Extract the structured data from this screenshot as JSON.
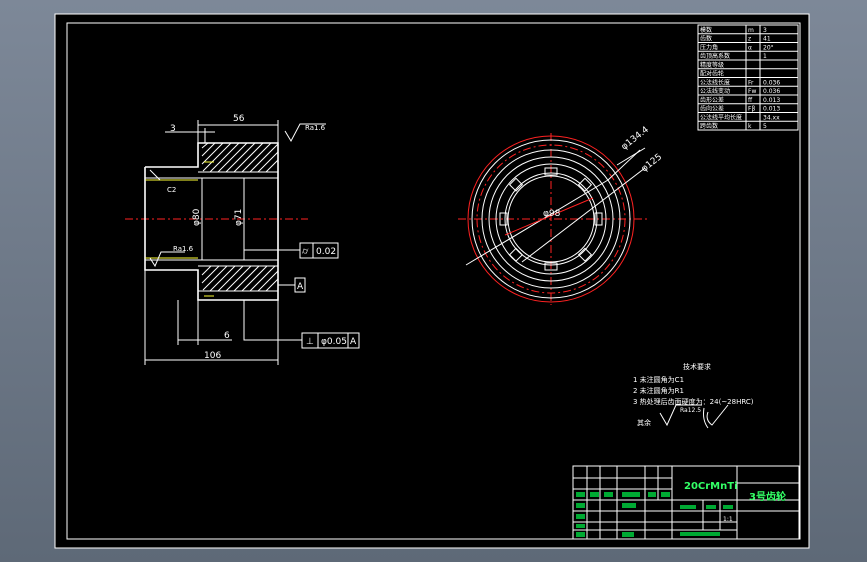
{
  "drawing": {
    "dimensions": {
      "d3": "3",
      "d56": "56",
      "d6": "6",
      "d106": "106",
      "phi80": "φ80",
      "phi71": "φ71",
      "phi93": "φ98",
      "phi125": "φ125",
      "phi134": "φ134.4",
      "chamfer": "C2"
    },
    "roughness": {
      "top": "Ra1.6",
      "left": "Ra1.6"
    },
    "tolerance": {
      "cyl_symbol": "⌭",
      "cyl_value": "0.02",
      "perp_symbol": "⊥",
      "perp_value": "φ0.05",
      "perp_datum": "A",
      "datum": "A"
    },
    "notes": {
      "title": "技术要求",
      "items": [
        "1  未注圆角为C1",
        "2  未注圆角为R1",
        "3  热处理后齿面硬度为：24(~28HRC)"
      ],
      "rest_label": "其余",
      "rest_ra": "Ra12.5"
    }
  },
  "title_block": {
    "material": "20CrMnTi",
    "part_name": "3号齿轮",
    "scale_label": "1:1"
  },
  "param_table": {
    "rows": [
      [
        "模数",
        "m",
        "3"
      ],
      [
        "齿数",
        "z",
        "41"
      ],
      [
        "压力角",
        "α",
        "20°"
      ],
      [
        "齿顶高系数",
        "",
        "1"
      ],
      [
        "精度等级",
        "",
        ""
      ],
      [
        "配对齿轮",
        "",
        ""
      ],
      [
        "公法线长度",
        "Fr",
        "0.036"
      ],
      [
        "公法线变动",
        "Fw",
        "0.036"
      ],
      [
        "齿形公差",
        "ff",
        "0.013"
      ],
      [
        "齿向公差",
        "Fβ",
        "0.013"
      ],
      [
        "公法线平均长度",
        "",
        "34.xx"
      ],
      [
        "跨齿数",
        "k",
        "5"
      ]
    ]
  }
}
